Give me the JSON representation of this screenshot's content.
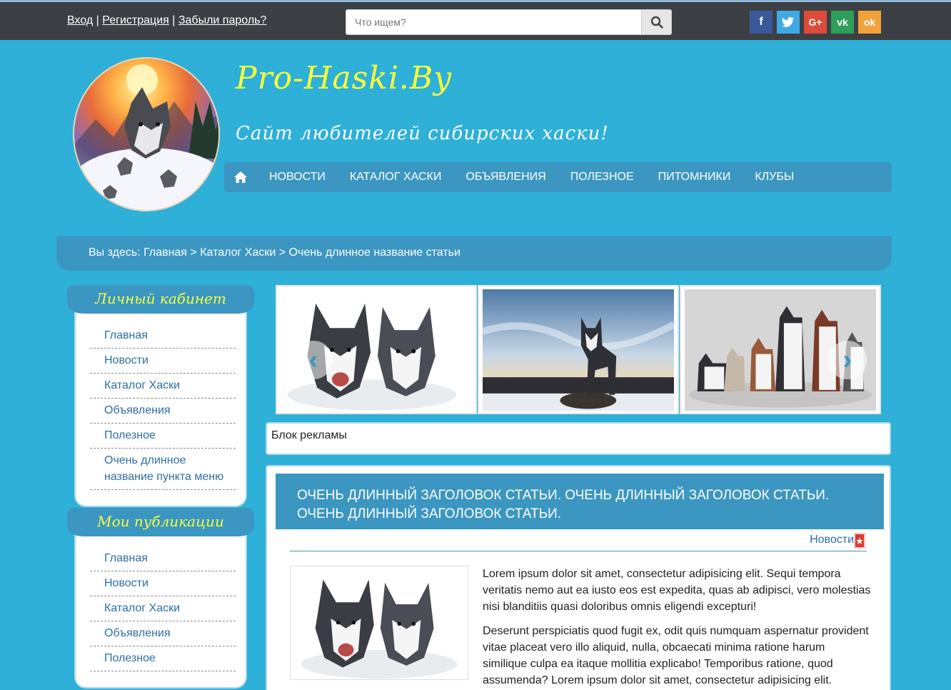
{
  "topbar": {
    "login": "Вход",
    "sep1": "|",
    "register": "Регистрация",
    "sep2": "|",
    "forgot": "Забыли пароль?",
    "search_placeholder": "Что ищем?",
    "socials": [
      {
        "name": "facebook",
        "glyph": "f",
        "color": "#3b5998"
      },
      {
        "name": "twitter",
        "glyph": "🐦",
        "color": "#3fa9e6"
      },
      {
        "name": "google-plus",
        "glyph": "G+",
        "color": "#dd4b39"
      },
      {
        "name": "vk",
        "glyph": "vk",
        "color": "#2e9e58"
      },
      {
        "name": "odnoklassniki",
        "glyph": "ok",
        "color": "#f2a23a"
      }
    ]
  },
  "header": {
    "title": "Pro-Haski.By",
    "subtitle": "Сайт любителей сибирских хаски!"
  },
  "nav": {
    "items": [
      "Новости",
      "Каталог хаски",
      "Объявления",
      "Полезное",
      "Питомники",
      "Клубы"
    ]
  },
  "breadcrumb": "Вы здесь: Главная > Каталог Хаски > Очень длинное название статьи",
  "sidebar": {
    "cabinet": {
      "title": "Личный кабинет",
      "items": [
        "Главная",
        "Новости",
        "Каталог Хаски",
        "Объявления",
        "Полезное",
        "Очень длинное название пункта меню"
      ]
    },
    "publications": {
      "title": "Мои публикации",
      "items": [
        "Главная",
        "Новости",
        "Каталог Хаски",
        "Объявления",
        "Полезное"
      ]
    }
  },
  "ad": "Блок рекламы",
  "article": {
    "title": "Очень длинный заголовок статьи. Очень длинный заголовок статьи. Очень длинный заголовок статьи.",
    "category": "Новости",
    "p1": "Lorem ipsum dolor sit amet, consectetur adipisicing elit. Sequi tempora veritatis nemo aut ea iusto eos est expedita, quas ab adipisci, vero molestias nisi blanditiis quasi doloribus omnis eligendi excepturi!",
    "p2": "Deserunt perspiciatis quod fugit ex, odit quis numquam aspernatur provident vitae placeat vero illo aliquid, nulla, obcaecati minima ratione harum similique culpa ea itaque mollitia explicabo! Temporibus ratione, quod assumenda? Lorem ipsum dolor sit amet, consectetur adipisicing elit."
  }
}
